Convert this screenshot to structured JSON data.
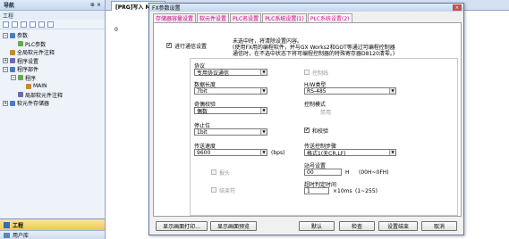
{
  "navigator": {
    "title": "导航",
    "pin": "⊕ ×",
    "subtitle": "工程",
    "tree": [
      {
        "label": "参数",
        "level": 0,
        "expander": "⊟"
      },
      {
        "label": "PLC参数",
        "level": 1,
        "expander": ""
      },
      {
        "label": "全局软元件注释",
        "level": 0,
        "expander": ""
      },
      {
        "label": "程序设置",
        "level": 0,
        "expander": "⊞"
      },
      {
        "label": "程序部件",
        "level": 0,
        "expander": "⊟"
      },
      {
        "label": "程序",
        "level": 1,
        "expander": "⊟"
      },
      {
        "label": "MAIN",
        "level": 2,
        "expander": ""
      },
      {
        "label": "局部软元件注释",
        "level": 1,
        "expander": ""
      },
      {
        "label": "软元件存储器",
        "level": 0,
        "expander": "⊞"
      }
    ],
    "bottom_button": "工程",
    "bottom_button2": "用户库"
  },
  "editor": {
    "tab_label": "[PRG]写入 MAIN",
    "step_number": "0"
  },
  "dialog": {
    "title": "FX参数设置",
    "close": "×",
    "tabs": [
      "存储器容量设置",
      "软元件设置",
      "PLC名设置",
      "PLC系统设置(1)",
      "PLC系统设置(2)"
    ],
    "comm_setting_label": "进行通信设置",
    "comm_setting_checked": true,
    "note_line1": "未选中时，将清除设置内容。",
    "note_line2": "(使用FX用的编程软件，并与GX Works2和GOT等通过可编程控制器",
    "note_line3": "通信时，在不选中状态下将可编程控制器的特殊寄存器D8120清零。)",
    "protocol_label": "协议",
    "protocol_value": "专用协议通信",
    "control_line_label": "控制线",
    "data_length_label": "数据长度",
    "data_length_value": "7bit",
    "hw_type_label": "H/W类型",
    "hw_type_value": "RS-485",
    "parity_label": "奇偶校验",
    "parity_value": "偶数",
    "control_mode_label": "控制模式",
    "control_mode_value": "禁用",
    "stop_bit_label": "停止位",
    "stop_bit_value": "1bit",
    "checksum_label": "和校验",
    "checksum_checked": true,
    "baud_label": "传送速度",
    "baud_value": "9600",
    "baud_unit": "(bps)",
    "transfer_step_label": "传送控制步骤",
    "transfer_step_value": "格式1(无CR,LF)",
    "header_label": "报头",
    "station_label": "站号设置",
    "station_value": "00",
    "station_suffix": "H",
    "station_range": "(00H~0FH)",
    "terminator_label": "结束符",
    "timeout_label": "超时判定时间",
    "timeout_value": "1",
    "timeout_unit": "×10ms",
    "timeout_range": "(1~255)",
    "buttons": {
      "print_window": "显示画面打印...",
      "print_preview": "显示画面预览",
      "default": "默认",
      "check": "检查",
      "finish": "设置结束",
      "cancel": "取消"
    }
  }
}
